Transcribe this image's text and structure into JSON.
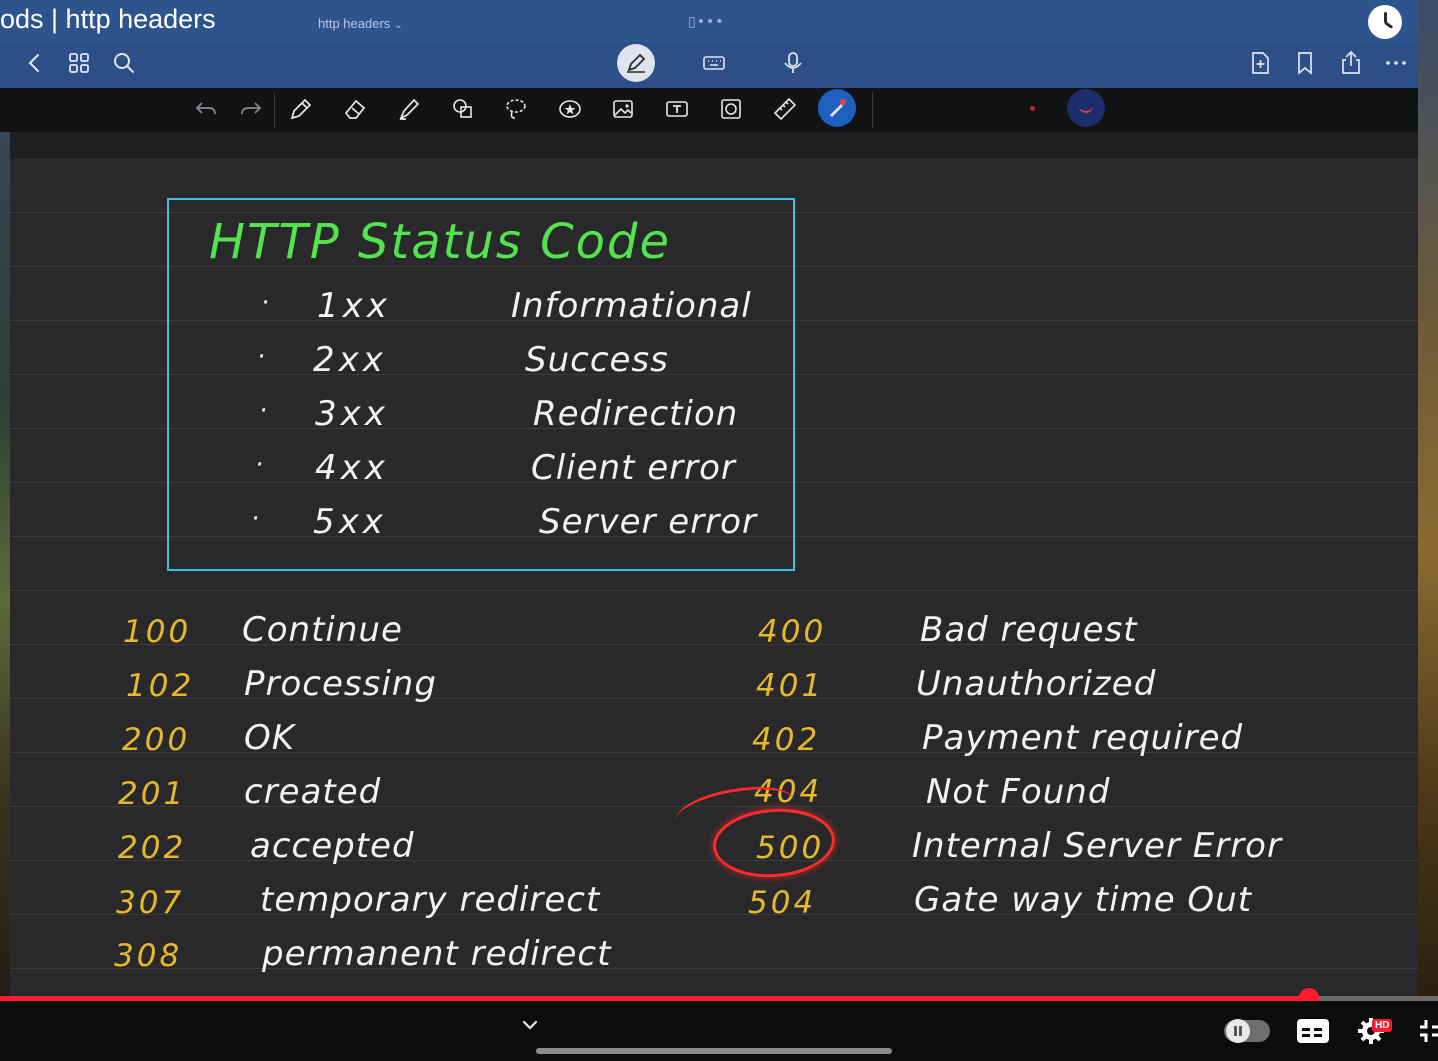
{
  "window": {
    "title": "ods | http headers",
    "tab_title": "http headers",
    "tab_chevron": "⌄",
    "multitask_dots": "▯•••"
  },
  "navbar": {
    "icons": [
      "back-chevron-icon",
      "grid-icon",
      "search-icon",
      "pen-mode-icon",
      "keyboard-icon",
      "microphone-icon",
      "add-page-icon",
      "bookmark-icon",
      "share-icon",
      "more-icon"
    ]
  },
  "toolbar": {
    "tools": [
      "undo-icon",
      "redo-icon",
      "pen-icon",
      "eraser-icon",
      "highlighter-icon",
      "shapes-icon",
      "lasso-icon",
      "sticker-icon",
      "image-icon",
      "textbox-icon",
      "camera-icon",
      "ruler-icon",
      "laser-pointer-icon"
    ],
    "active_color": "#1f5fc0"
  },
  "notes": {
    "box_title": "HTTP  Status  Code",
    "categories": [
      {
        "bullet": "·",
        "code": "1xx",
        "label": "Informational"
      },
      {
        "bullet": "·",
        "code": "2xx",
        "label": "Success"
      },
      {
        "bullet": "·",
        "code": "3xx",
        "label": "Redirection"
      },
      {
        "bullet": "·",
        "code": "4xx",
        "label": "Client  error"
      },
      {
        "bullet": "·",
        "code": "5xx",
        "label": "Server  error"
      }
    ],
    "left_codes": [
      {
        "code": "100",
        "desc": "Continue"
      },
      {
        "code": "102",
        "desc": "Processing"
      },
      {
        "code": "200",
        "desc": "OK"
      },
      {
        "code": "201",
        "desc": "created"
      },
      {
        "code": "202",
        "desc": "accepted"
      },
      {
        "code": "307",
        "desc": "temporary  redirect"
      },
      {
        "code": "308",
        "desc": "permanent  redirect"
      }
    ],
    "right_codes": [
      {
        "code": "400",
        "desc": "Bad  request"
      },
      {
        "code": "401",
        "desc": "Unauthorized"
      },
      {
        "code": "402",
        "desc": "Payment  required"
      },
      {
        "code": "404",
        "desc": "Not  Found"
      },
      {
        "code": "500",
        "desc": "Internal  Server  Error"
      },
      {
        "code": "504",
        "desc": "Gate way  time Out"
      }
    ],
    "colors": {
      "title": "#52e34e",
      "box_border": "#39c2e0",
      "codes": "#e6b82c",
      "ink": "#f2f2f2",
      "highlight": "#ff2a2a"
    }
  },
  "player": {
    "progress_fraction": 0.91,
    "hd_badge": "HD",
    "accent": "#ff1a2e"
  }
}
